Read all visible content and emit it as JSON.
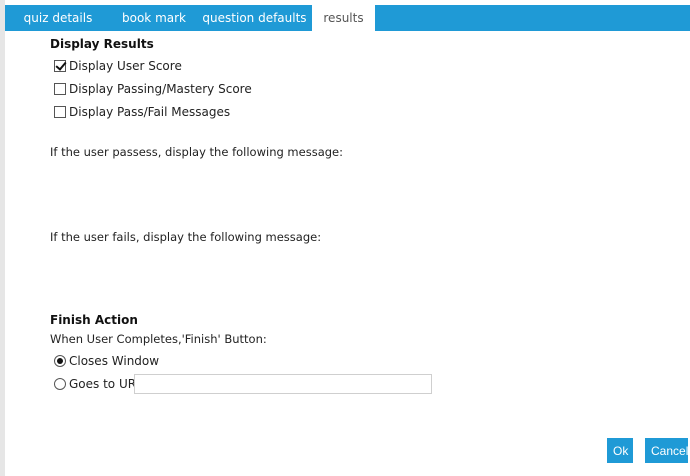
{
  "tabs": [
    {
      "label": "quiz details"
    },
    {
      "label": "book mark"
    },
    {
      "label": "question defaults"
    },
    {
      "label": "results"
    }
  ],
  "display_results": {
    "title": "Display Results",
    "options": [
      {
        "label": "Display User Score",
        "checked": true
      },
      {
        "label": "Display Passing/Mastery Score",
        "checked": false
      },
      {
        "label": "Display Pass/Fail Messages",
        "checked": false
      }
    ]
  },
  "messages": {
    "pass_label": "If the user passess, display the following message:",
    "fail_label": "If the user fails, display the following message:"
  },
  "finish_action": {
    "title": "Finish Action",
    "subtitle": "When User Completes,'Finish' Button:",
    "options": [
      {
        "label": "Closes Window",
        "selected": true
      },
      {
        "label": "Goes to URL",
        "selected": false
      }
    ],
    "url_value": ""
  },
  "buttons": {
    "ok": "Ok",
    "cancel": "Cancel"
  },
  "colors": {
    "accent": "#1f9ad6"
  }
}
